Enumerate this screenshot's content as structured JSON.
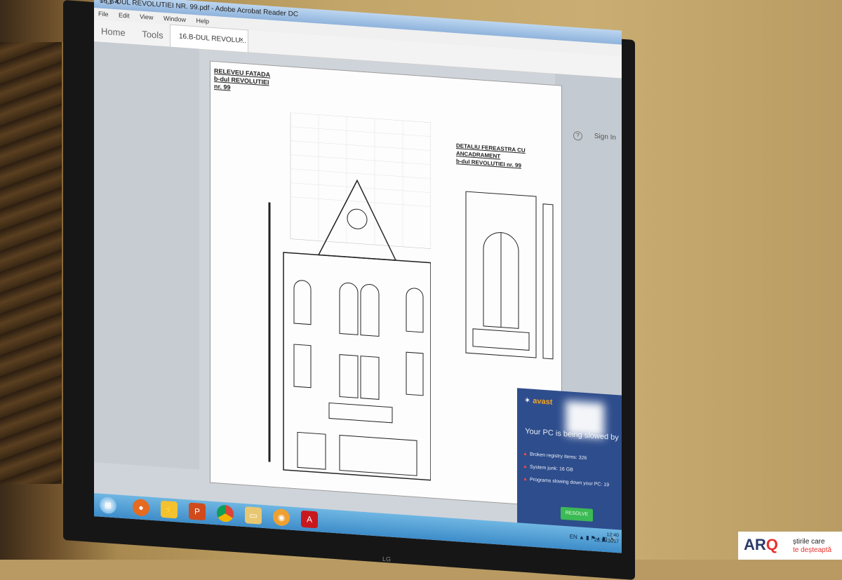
{
  "window": {
    "title": "16.B-DUL REVOLUTIEI  NR. 99.pdf - Adobe Acrobat Reader DC",
    "controls": "– ▢ ✕"
  },
  "menu": [
    "File",
    "Edit",
    "View",
    "Window",
    "Help"
  ],
  "toolbar": {
    "home": "Home",
    "tools": "Tools",
    "tab_label": "16.B-DUL REVOLU...",
    "tab_close": "×",
    "help": "?",
    "sign_in": "Sign In"
  },
  "drawing": {
    "title_lines": [
      "RELEVEU FATADA",
      "b-dul REVOLUTIEI",
      "nr. 99"
    ],
    "detail_lines": [
      "DETALIU FEREASTRA CU ANCADRAMENT",
      "b-dul REVOLUTIEI nr. 99"
    ]
  },
  "avast": {
    "logo": "avast",
    "headline": "Your PC is being slowed by",
    "items": [
      "Broken registry items: 326",
      "System junk: 16 GB",
      "Programs slowing down your PC: 19"
    ],
    "button": "RESOLVE"
  },
  "taskbar": {
    "tray_lang": "EN",
    "clock_time": "12:40",
    "clock_date": "26.10.2017"
  },
  "monitor_brand": "LG",
  "logo": {
    "mark_ar": "AR",
    "mark_q": "Q",
    "tag_line1": "știrile care",
    "tag_line2": "te deșteaptă"
  },
  "colors": {
    "taskbar": "#3d8cc9",
    "avast_panel": "#2e4d8c",
    "resolve_button": "#3cba54",
    "logo_red": "#e8312c",
    "logo_navy": "#2b3a67"
  }
}
